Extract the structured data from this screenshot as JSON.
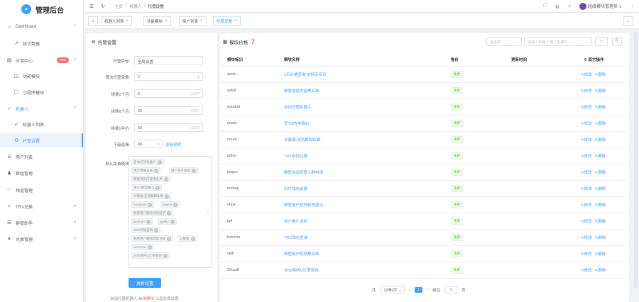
{
  "app": {
    "logo_text": "管理后台"
  },
  "sidebar": {
    "items": [
      {
        "label": "Dashboard",
        "icon": "home-icon",
        "arrow": "^"
      },
      {
        "label": "统计数据",
        "icon": "trend-icon"
      },
      {
        "label": "应用中心",
        "icon": "app-icon",
        "badge": "new",
        "arrow": "^"
      },
      {
        "label": "功能模块",
        "icon": "module-icon"
      },
      {
        "label": "小程序模块",
        "icon": "miniapp-icon"
      },
      {
        "label": "机器人",
        "icon": "robot-icon",
        "arrow": "^"
      },
      {
        "label": "机器人列表",
        "icon": "robot-icon"
      },
      {
        "label": "托管设置",
        "icon": "gear-icon"
      },
      {
        "label": "用户列表",
        "icon": "user-icon"
      },
      {
        "label": "群组管理",
        "icon": "group-icon"
      },
      {
        "label": "频道管理",
        "icon": "channel-icon"
      },
      {
        "label": "TRX兑换",
        "icon": "exchange-icon",
        "arrow": "v"
      },
      {
        "label": "群管助手",
        "icon": "helper-icon",
        "arrow": "v"
      },
      {
        "label": "兑换管理",
        "icon": "yen-icon",
        "arrow": "v"
      }
    ]
  },
  "topbar": {
    "crumbs": [
      "主页",
      "/",
      "机器人",
      "/",
      "托管设置"
    ],
    "user": "超级模块管理员 ∨"
  },
  "tabs": [
    {
      "label": "机器人列表"
    },
    {
      "label": "功能模块"
    },
    {
      "label": "用户列表"
    },
    {
      "label": "托管设置"
    }
  ],
  "settings": {
    "title": "托管设置",
    "fields": [
      {
        "label": "托管目标:",
        "value": "全局设置"
      },
      {
        "label": "首次托管免费:",
        "value": "2",
        "suffix": "天"
      },
      {
        "label": "续费1个月:",
        "value": "5",
        "suffix": "USDT"
      },
      {
        "label": "续费6个月:",
        "value": "25",
        "suffix": "USDT"
      },
      {
        "label": "续费1年价:",
        "value": "50",
        "suffix": "USDT"
      },
      {
        "label": "下级返佣:",
        "value": "80",
        "suffix": "%",
        "link": "返佣说明"
      }
    ],
    "modules_label": "默认免费模块:",
    "tags": [
      "自动托管机器人",
      "用户转账记录",
      "用户资产查询",
      "群管消息内容黑名单",
      "查TG的电报ID",
      "计算器-支持群和私聊",
      "hongbao",
      "kaiqun",
      "群管用户删除消息提示",
      "jiaofuan",
      "qiyeliy",
      "TRC转账查询",
      "群管用户删除消息记录",
      "cx搜索",
      "welcome",
      "20交易所U汇率查询"
    ],
    "submit": "更新设置",
    "footer_prefix": "自动托管机器人",
    "footer_link": "启用模块",
    "footer_suffix": "以及免费设置"
  },
  "price": {
    "title": "模块价格",
    "search_select": "请选择",
    "search_placeholder": "请输入机器人/用户名或ID...",
    "columns": [
      "模块标识",
      "模块名称",
      "售价",
      "更新时间",
      "⚙ 其它操作"
    ],
    "rows": [
      {
        "key": "accin",
        "name": "1币价格查询 支持币名币",
        "price": "免费",
        "ops": true
      },
      {
        "key": "adkill",
        "name": "群管消息内容黑名单",
        "price": "免费",
        "ops": true
      },
      {
        "key": "autobot",
        "name": "自动托管机器人",
        "price": "免费",
        "ops": true
      },
      {
        "key": "chaid",
        "name": "查TG的电报ID",
        "price": "免费",
        "ops": true
      },
      {
        "key": "count",
        "name": "计算器-支持群和私聊",
        "price": "免费",
        "ops": true
      },
      {
        "key": "gdtrx",
        "name": "TRX自动兑换",
        "price": "免费",
        "ops": true
      },
      {
        "key": "jinqun",
        "name": "群管自动同意入群申请",
        "price": "免费",
        "ops": true
      },
      {
        "key": "money",
        "name": "用户钱包余额",
        "price": "免费",
        "ops": true
      },
      {
        "key": "nbpx",
        "name": "群管用户昵称修改提示",
        "price": "免费",
        "ops": true
      },
      {
        "key": "tgll",
        "name": "用户推广返利",
        "price": "免费",
        "ops": true
      },
      {
        "key": "troncha",
        "name": "TRC钱包查询",
        "price": "免费",
        "ops": true
      },
      {
        "key": "ukill",
        "name": "群管用户昵称黑名单",
        "price": "免费",
        "ops": true
      },
      {
        "key": "20usdt",
        "name": "20交易所U汇率查询",
        "price": "免费",
        "ops": true
      }
    ],
    "edit": "修改",
    "del": "删除",
    "pager": {
      "total": "共",
      "size": "20条/页",
      "page": "1",
      "goto": "前往",
      "goto_page": "1",
      "page_unit": "页"
    }
  }
}
